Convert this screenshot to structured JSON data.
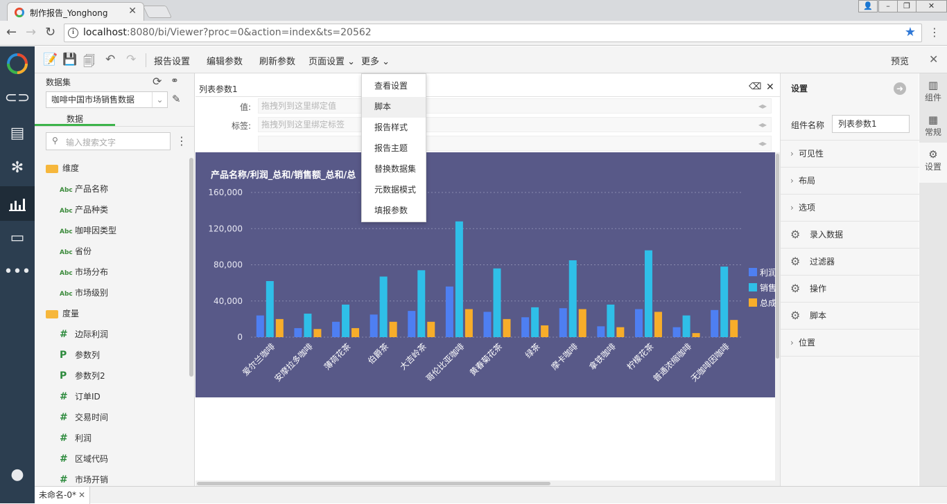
{
  "browser": {
    "tab_title": "制作报告_Yonghong",
    "tab_close": "✕",
    "url_host": "localhost",
    "url_rest": ":8080/bi/Viewer?proc=0&action=index&ts=20562"
  },
  "toolbar": {
    "report_settings": "报告设置",
    "edit_params": "编辑参数",
    "refresh_params": "刷新参数",
    "page_settings": "页面设置",
    "more": "更多",
    "preview": "预览"
  },
  "more_menu": {
    "items": [
      "查看设置",
      "脚本",
      "报告样式",
      "报告主题",
      "替换数据集",
      "元数据模式",
      "填报参数"
    ]
  },
  "dataset_panel": {
    "title": "数据集",
    "selected_dataset": "咖啡中国市场销售数据",
    "tab_data": "数据",
    "search_placeholder": "输入搜索文字",
    "dimension_group": "维度",
    "dimensions": [
      "产品名称",
      "产品种类",
      "咖啡因类型",
      "省份",
      "市场分布",
      "市场级别"
    ],
    "dim_badge": "Abc",
    "measure_group": "度量",
    "measures": [
      {
        "icon": "#",
        "label": "边际利润"
      },
      {
        "icon": "P",
        "label": "参数列"
      },
      {
        "icon": "P",
        "label": "参数列2"
      },
      {
        "icon": "#",
        "label": "订单ID"
      },
      {
        "icon": "#",
        "label": "交易时间"
      },
      {
        "icon": "#",
        "label": "利润"
      },
      {
        "icon": "#",
        "label": "区域代码"
      },
      {
        "icon": "#",
        "label": "市场开销"
      }
    ]
  },
  "param_component": {
    "title": "列表参数1",
    "value_label": "值:",
    "value_placeholder": "拖拽列到这里绑定值",
    "tag_label": "标签:",
    "tag_placeholder": "拖拽列到这里绑定标签"
  },
  "chart_data": {
    "type": "bar",
    "title": "产品名称/利润_总和/销售额_总和/总",
    "categories": [
      "爱尔兰咖啡",
      "安摩拉多咖啡",
      "薄荷花茶",
      "伯爵茶",
      "大吉岭茶",
      "哥伦比亚咖啡",
      "黄春菊花茶",
      "绿茶",
      "摩卡咖啡",
      "拿铁咖啡",
      "柠檬花茶",
      "普通浓缩咖啡",
      "无咖啡因咖啡"
    ],
    "series": [
      {
        "name": "利润",
        "color": "#4e7ff2",
        "values": [
          24000,
          10000,
          17000,
          25000,
          29000,
          56000,
          28000,
          22000,
          32000,
          12000,
          31000,
          11000,
          30000
        ]
      },
      {
        "name": "销售",
        "color": "#2fbfe8",
        "values": [
          62000,
          26000,
          36000,
          67000,
          74000,
          128000,
          76000,
          33000,
          85000,
          36000,
          96000,
          24000,
          78000
        ]
      },
      {
        "name": "总成",
        "color": "#f7ad2a",
        "values": [
          20000,
          9000,
          10000,
          17000,
          17000,
          31000,
          20000,
          13000,
          31000,
          11000,
          28000,
          4500,
          19000
        ]
      }
    ],
    "ylim": [
      0,
      160000
    ],
    "yticks": [
      "0",
      "40,000",
      "80,000",
      "120,000",
      "160,000"
    ],
    "ytick_values": [
      0,
      40000,
      80000,
      120000,
      160000
    ],
    "grid": true,
    "legend": "right"
  },
  "settings_panel": {
    "title": "设置",
    "component_name_label": "组件名称",
    "component_name_value": "列表参数1",
    "sections": [
      {
        "type": "chevron",
        "label": "可见性"
      },
      {
        "type": "chevron",
        "label": "布局"
      },
      {
        "type": "chevron",
        "label": "选项"
      },
      {
        "type": "gear",
        "label": "录入数据"
      },
      {
        "type": "gear",
        "label": "过滤器"
      },
      {
        "type": "gear",
        "label": "操作"
      },
      {
        "type": "gear",
        "label": "脚本"
      },
      {
        "type": "chevron",
        "label": "位置"
      }
    ]
  },
  "right_tabs": [
    "组件",
    "常规",
    "设置"
  ],
  "bottom": {
    "file_tab": "未命名-0*"
  }
}
